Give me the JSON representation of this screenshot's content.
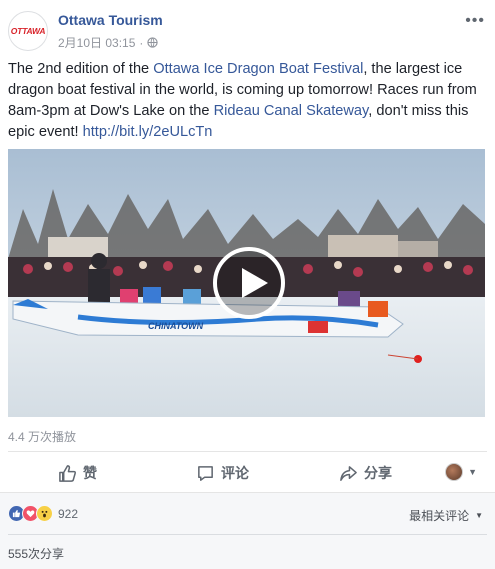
{
  "header": {
    "page_name": "Ottawa Tourism",
    "logo_text": "OTTAWA",
    "timestamp": "2月10日 03:15",
    "separator": "·",
    "more_icon": "ellipsis-icon",
    "privacy_icon": "globe-icon"
  },
  "post": {
    "text_1": "The 2nd edition of the ",
    "link_festival": "Ottawa Ice Dragon Boat Festival",
    "text_2": ", the largest ice dragon boat festival in the world, is coming up tomorrow! Races run from 8am-3pm at Dow's Lake on the ",
    "link_canal": "Rideau Canal Skateway",
    "text_3": ", don't miss this epic event! ",
    "link_short": "http://bit.ly/2eULcTn"
  },
  "video": {
    "boat_label": "CHINATOWN",
    "play_icon": "play-icon"
  },
  "views": "4.4 万次播放",
  "actions": {
    "like": "赞",
    "comment": "评论",
    "share": "分享"
  },
  "footer": {
    "reaction_count": "922",
    "sort_label": "最相关评论",
    "shares": "555次分享"
  },
  "colors": {
    "link": "#365899",
    "like_blue": "#4267b2",
    "love_red": "#f25268",
    "wow_yellow": "#f7d046"
  }
}
